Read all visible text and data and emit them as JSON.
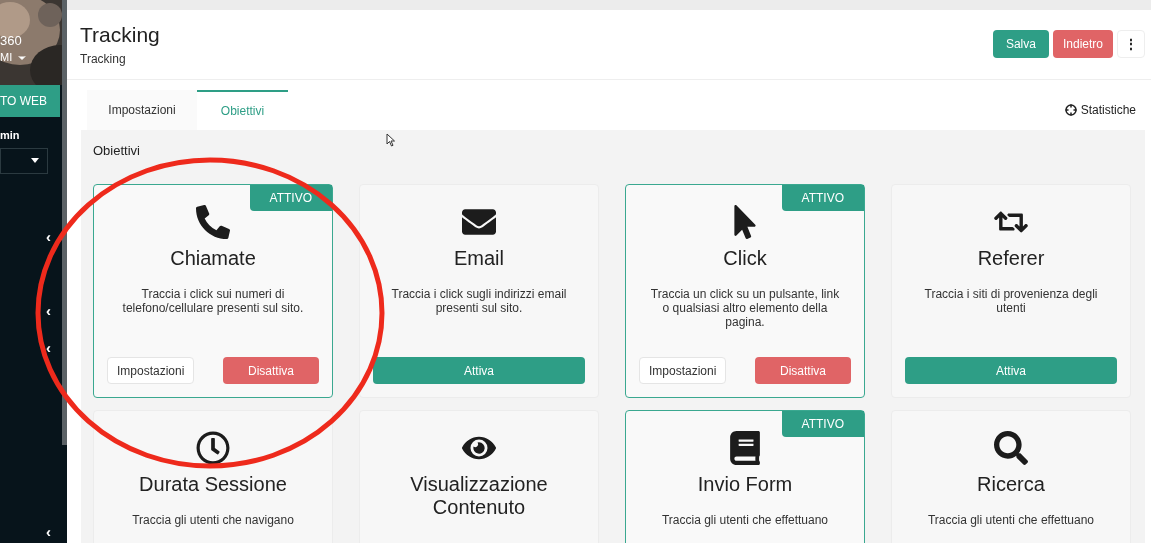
{
  "sidebar": {
    "brand_number": "360",
    "user": "MI",
    "banner_button": "TO WEB",
    "section_label": "min",
    "chevrons": [
      "‹",
      "‹",
      "‹",
      "‹"
    ]
  },
  "header": {
    "title": "Tracking",
    "breadcrumb": "Tracking",
    "buttons": [
      {
        "label": "Salva",
        "kind": "primary"
      },
      {
        "label": "Indietro",
        "kind": "danger"
      },
      {
        "label": "⋮",
        "kind": "menu"
      }
    ]
  },
  "tabs": [
    {
      "label": "Impostazioni",
      "selected": false
    },
    {
      "label": "Obiettivi",
      "selected": true
    }
  ],
  "stats_link": "Statistiche",
  "panel": {
    "heading": "Obiettivi",
    "goals": [
      {
        "title": "Chiamate",
        "description": "Traccia i click sui numeri di telefono/cellulare presenti sul sito.",
        "active": true,
        "badge": "ATTIVO",
        "buttons": [
          "Impostazioni",
          "Disattiva"
        ]
      },
      {
        "title": "Email",
        "description": "Traccia i click sugli indirizzi email presenti sul sito.",
        "active": false,
        "buttons": [
          "Attiva"
        ]
      },
      {
        "title": "Click",
        "description": "Traccia un click su un pulsante, link o qualsiasi altro elemento della pagina.",
        "active": true,
        "badge": "ATTIVO",
        "buttons": [
          "Impostazioni",
          "Disattiva"
        ]
      },
      {
        "title": "Referer",
        "description": "Traccia i siti di provenienza degli utenti",
        "active": false,
        "buttons": [
          "Attiva"
        ]
      },
      {
        "title": "Durata Sessione",
        "description": "Traccia gli utenti che navigano",
        "active": false
      },
      {
        "title": "Visualizzazione Contenuto",
        "active": false
      },
      {
        "title": "Invio Form",
        "description": "Traccia gli utenti che effettuano",
        "active": true,
        "badge": "ATTIVO"
      },
      {
        "title": "Ricerca",
        "description": "Traccia gli utenti che effettuano",
        "active": false
      }
    ]
  }
}
